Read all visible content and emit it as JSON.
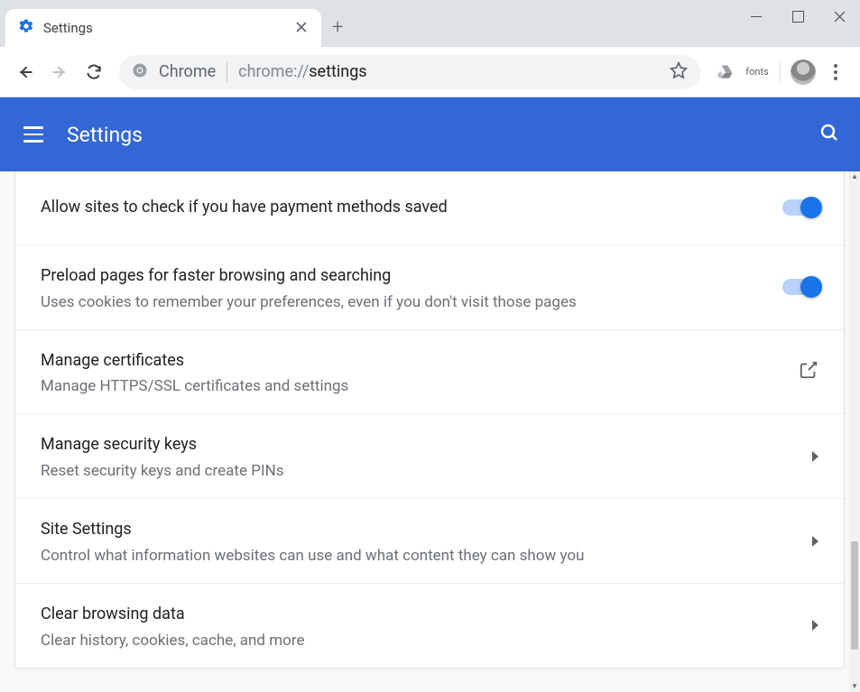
{
  "window": {
    "tab_title": "Settings"
  },
  "toolbar": {
    "omnibox_label": "Chrome",
    "url_prefix": "chrome://",
    "url_path": "settings",
    "fonts_label": "fonts"
  },
  "header": {
    "title": "Settings"
  },
  "rows": [
    {
      "title": "Allow sites to check if you have payment methods saved",
      "sub": "",
      "control": "toggle",
      "on": true
    },
    {
      "title": "Preload pages for faster browsing and searching",
      "sub": "Uses cookies to remember your preferences, even if you don't visit those pages",
      "control": "toggle",
      "on": true
    },
    {
      "title": "Manage certificates",
      "sub": "Manage HTTPS/SSL certificates and settings",
      "control": "external"
    },
    {
      "title": "Manage security keys",
      "sub": "Reset security keys and create PINs",
      "control": "arrow"
    },
    {
      "title": "Site Settings",
      "sub": "Control what information websites can use and what content they can show you",
      "control": "arrow"
    },
    {
      "title": "Clear browsing data",
      "sub": "Clear history, cookies, cache, and more",
      "control": "arrow"
    }
  ]
}
